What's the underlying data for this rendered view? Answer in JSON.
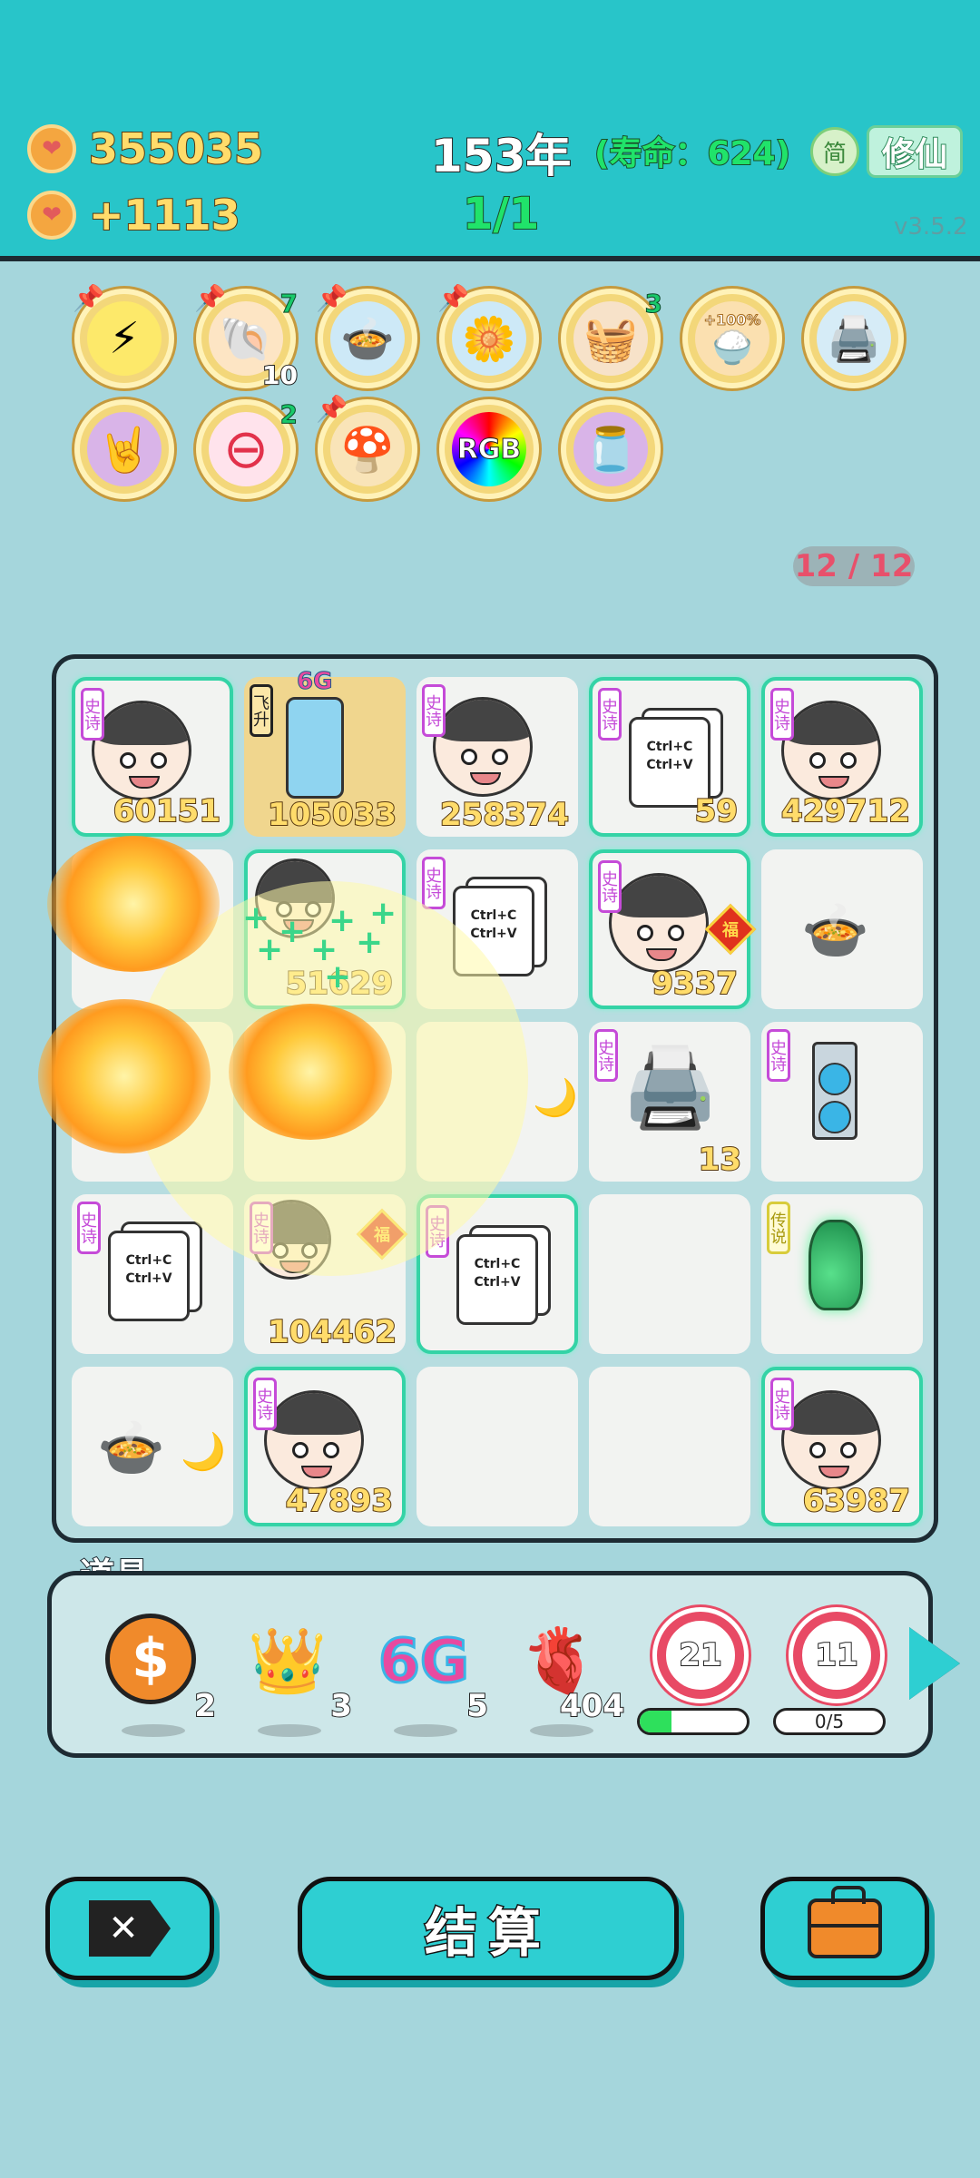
{
  "header": {
    "coins": "355035",
    "income": "+1113",
    "year": "153年",
    "lifespan": "(寿命：624)",
    "round": "1/1",
    "lang_button": "简",
    "cultivate_button": "修仙",
    "version": "v3.5.2"
  },
  "relics": [
    {
      "name": "lightning-relic",
      "icon": "⚡",
      "pinned": true
    },
    {
      "name": "shell-relic",
      "icon": "🐚",
      "pinned": true,
      "count_top": "7",
      "count_bottom": "10"
    },
    {
      "name": "rice-cooker-relic",
      "icon": "🍲",
      "pinned": true
    },
    {
      "name": "flower-pot-relic",
      "icon": "🌼",
      "pinned": true
    },
    {
      "name": "basket-relic",
      "icon": "🧺",
      "count_top": "3"
    },
    {
      "name": "rice-bowl-relic",
      "icon": "🍚",
      "label": "+100%"
    },
    {
      "name": "printer-relic",
      "icon": "🖨️"
    },
    {
      "name": "rock-hand-relic",
      "icon": "🤘"
    },
    {
      "name": "minus-relic",
      "icon": "⊖",
      "count_top": "2"
    },
    {
      "name": "mushroom-cloud-relic",
      "icon": "🍄",
      "pinned": true
    },
    {
      "name": "rgb-relic",
      "label": "RGB"
    },
    {
      "name": "jar-relic",
      "icon": "🫙"
    }
  ],
  "slot_counter": "12 / 12",
  "board": {
    "rows": [
      [
        {
          "type": "face",
          "tag": "史诗",
          "value": "60151",
          "glow": true
        },
        {
          "type": "fridge",
          "tag": "飞升",
          "top_label": "6G",
          "value": "105033",
          "gold": true
        },
        {
          "type": "face",
          "tag": "史诗",
          "value": "258374"
        },
        {
          "type": "copy",
          "tag": "史诗",
          "value": "59",
          "glow": true
        },
        {
          "type": "face",
          "tag": "史诗",
          "value": "429712",
          "glow": true
        }
      ],
      [
        {
          "type": "burst"
        },
        {
          "type": "face-small",
          "value": "51629",
          "glow": true
        },
        {
          "type": "copy",
          "tag": "史诗"
        },
        {
          "type": "face",
          "tag": "史诗",
          "value": "9337",
          "glow": true,
          "fu": "福"
        },
        {
          "type": "pot"
        }
      ],
      [
        {
          "type": "burst"
        },
        {
          "type": "burst"
        },
        {
          "type": "moon"
        },
        {
          "type": "printer",
          "tag": "史诗",
          "value": "13"
        },
        {
          "type": "gpu",
          "tag": "史诗"
        }
      ],
      [
        {
          "type": "copy",
          "tag": "史诗"
        },
        {
          "type": "face-small",
          "tag": "史诗",
          "value": "104462",
          "fu": "福"
        },
        {
          "type": "copy",
          "tag": "史诗",
          "glow": true
        },
        {
          "type": "empty"
        },
        {
          "type": "vase",
          "tag": "传说",
          "legend": true
        }
      ],
      [
        {
          "type": "pot-moon"
        },
        {
          "type": "face",
          "tag": "史诗",
          "value": "47893",
          "glow": true
        },
        {
          "type": "empty"
        },
        {
          "type": "empty"
        },
        {
          "type": "face",
          "tag": "史诗",
          "value": "63987",
          "glow": true
        }
      ]
    ],
    "copy_text": "Ctrl+C\nCtrl+V"
  },
  "items": {
    "title": "道具",
    "list": [
      {
        "name": "dollar-coin-item",
        "icon": "$",
        "count": "2"
      },
      {
        "name": "crown-item",
        "icon": "👑",
        "count": "3"
      },
      {
        "name": "6g-item",
        "label": "6G",
        "count": "5"
      },
      {
        "name": "liver-item",
        "icon": "🫀",
        "count": "404"
      },
      {
        "name": "target-item",
        "value": "21",
        "progress": 0.3
      },
      {
        "name": "target-item",
        "value": "11",
        "progress_text": "0/5",
        "progress": 0
      }
    ]
  },
  "bottom": {
    "settle_label": "结算"
  },
  "colors": {
    "background": "#a5d6dc",
    "header": "#28c5c9",
    "glow_border": "#34d3a6",
    "epic_tag": "#c54bd8",
    "gold_number": "#ffdc6b"
  }
}
